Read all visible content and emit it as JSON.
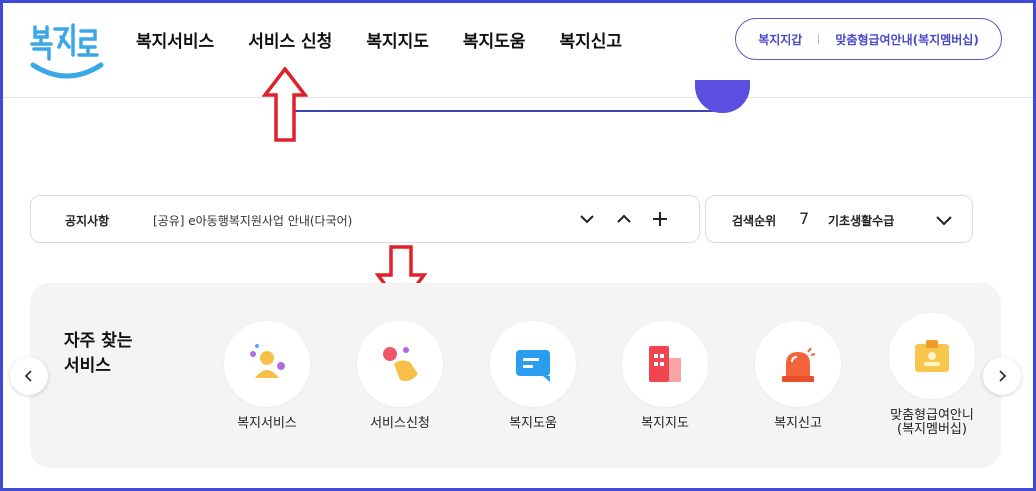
{
  "header": {
    "nav": [
      "복지서비스",
      "서비스 신청",
      "복지지도",
      "복지도움",
      "복지신고"
    ],
    "pill": {
      "left": "복지지갑",
      "right": "맞춤형급여안내(복지멤버십)"
    }
  },
  "notice": {
    "label": "공지사항",
    "text": "[공유] e아동행복지원사업 안내(다국어)"
  },
  "rank": {
    "label": "검색순위",
    "number": "7",
    "keyword": "기초생활수급"
  },
  "services": {
    "title_line1": "자주 찾는",
    "title_line2": "서비스",
    "items": [
      {
        "label": "복지서비스",
        "icon": "person-icon"
      },
      {
        "label": "서비스신청",
        "icon": "hand-tap-icon"
      },
      {
        "label": "복지도움",
        "icon": "chat-bubble-icon"
      },
      {
        "label": "복지지도",
        "icon": "building-icon"
      },
      {
        "label": "복지신고",
        "icon": "siren-icon"
      },
      {
        "label_line1": "맞춤형급여안니",
        "label_line2": "(복지멤버십)",
        "icon": "id-badge-icon"
      }
    ]
  },
  "colors": {
    "accent": "#5a4fe0",
    "frame": "#3f4bd6",
    "annotation_arrow": "#e0202a"
  }
}
